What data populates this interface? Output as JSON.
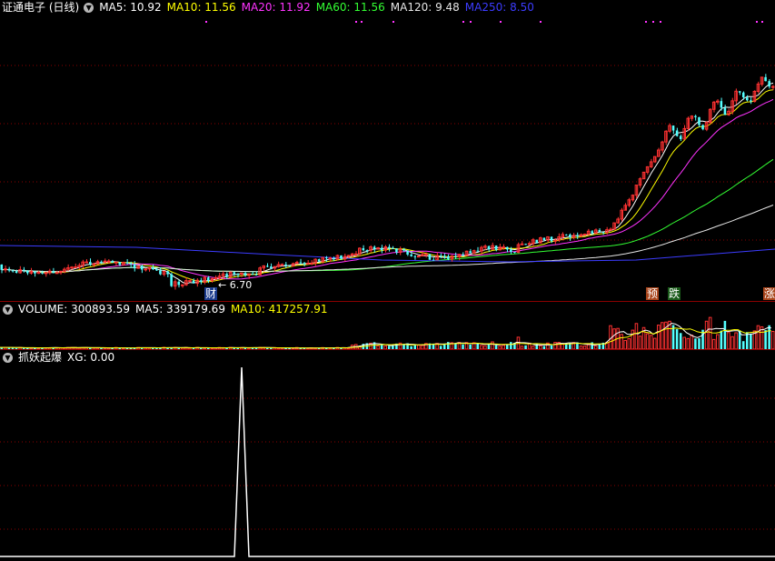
{
  "main": {
    "stock_title": "证通电子 (日线)",
    "ma": [
      {
        "label": "MA5: 10.92",
        "color": "#ffffff"
      },
      {
        "label": "MA10: 11.56",
        "color": "#ffff00"
      },
      {
        "label": "MA20: 11.92",
        "color": "#ff33ff"
      },
      {
        "label": "MA60: 11.56",
        "color": "#33ff33"
      },
      {
        "label": "MA120: 9.48",
        "color": "#e6e6e6"
      },
      {
        "label": "MA250: 8.50",
        "color": "#3c3cff"
      }
    ],
    "low_label": "6.70",
    "tags": [
      {
        "text": "财",
        "bg": "#1a3a8c"
      },
      {
        "text": "预",
        "bg": "#a8441a"
      },
      {
        "text": "跌",
        "bg": "#1a5a1a"
      },
      {
        "text": "涨",
        "bg": "#a8441a"
      }
    ]
  },
  "volume": {
    "label": "VOLUME: 300893.59",
    "ma5": "MA5: 339179.69",
    "ma10": "MA10: 417257.91"
  },
  "indicator": {
    "name": "抓妖起爆",
    "xg": "XG: 0.00"
  },
  "colors": {
    "up": "#ff3232",
    "down": "#54ffff",
    "grid": "#8a0000"
  }
}
